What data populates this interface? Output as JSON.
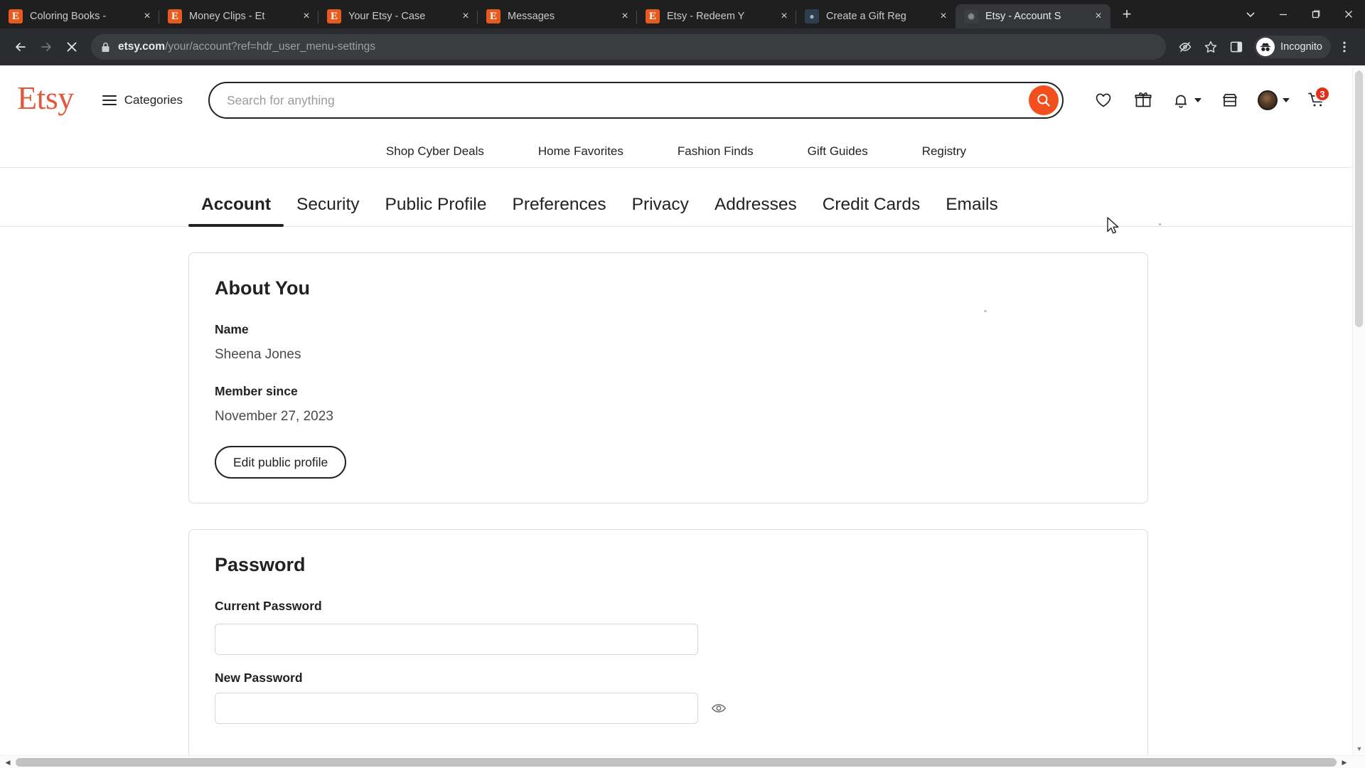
{
  "browser": {
    "tabs": [
      {
        "title": "Coloring Books -",
        "favicon": "etsy-icon",
        "active": false
      },
      {
        "title": "Money Clips - Et",
        "favicon": "etsy-icon",
        "active": false
      },
      {
        "title": "Your Etsy - Case",
        "favicon": "etsy-icon",
        "active": false
      },
      {
        "title": "Messages",
        "favicon": "etsy-icon",
        "active": false
      },
      {
        "title": "Etsy - Redeem Y",
        "favicon": "etsy-icon",
        "active": false
      },
      {
        "title": "Create a Gift Reg",
        "favicon": "generic-site-icon",
        "active": false
      },
      {
        "title": "Etsy - Account S",
        "favicon": "dim-site-icon",
        "active": true
      }
    ],
    "new_tab_label": "+",
    "close_label": "×",
    "window_controls": {
      "tab_search": "chevron-down-icon",
      "minimize": "minimize-icon",
      "maximize": "maximize-icon",
      "close": "close-icon"
    },
    "toolbar": {
      "back": "back-arrow-icon",
      "forward": "forward-arrow-icon",
      "stop": "stop-loading-icon",
      "lock": "lock-icon",
      "url_domain": "etsy.com",
      "url_path": "/your/account?ref=hdr_user_menu-settings",
      "tracking_protection": "eye-off-icon",
      "bookmark": "star-icon",
      "side_panel": "side-panel-icon",
      "incognito_label": "Incognito",
      "incognito_avatar": "incognito-hat-icon",
      "menu": "three-dot-menu-icon"
    }
  },
  "etsy": {
    "logo_text": "Etsy",
    "logo_color": "#e1593b",
    "accent_color": "#f1501e",
    "categories_label": "Categories",
    "search": {
      "placeholder": "Search for anything",
      "value": "",
      "button_icon": "search-icon"
    },
    "header_icons": [
      {
        "name": "favorites-icon",
        "label": "Favorites"
      },
      {
        "name": "gift-icon",
        "label": "Gifts"
      },
      {
        "name": "bell-icon",
        "label": "Notifications"
      },
      {
        "name": "shop-icon",
        "label": "Your shop"
      },
      {
        "name": "avatar-icon",
        "label": "You"
      },
      {
        "name": "cart-icon",
        "label": "Cart"
      }
    ],
    "cart_count": "3",
    "subnav": [
      {
        "label": "Shop Cyber Deals"
      },
      {
        "label": "Home Favorites"
      },
      {
        "label": "Fashion Finds"
      },
      {
        "label": "Gift Guides"
      },
      {
        "label": "Registry"
      }
    ]
  },
  "settings": {
    "tabs": [
      {
        "label": "Account",
        "active": true
      },
      {
        "label": "Security",
        "active": false
      },
      {
        "label": "Public Profile",
        "active": false
      },
      {
        "label": "Preferences",
        "active": false
      },
      {
        "label": "Privacy",
        "active": false
      },
      {
        "label": "Addresses",
        "active": false
      },
      {
        "label": "Credit Cards",
        "active": false
      },
      {
        "label": "Emails",
        "active": false
      }
    ],
    "about_you": {
      "heading": "About You",
      "name_label": "Name",
      "name_value": "Sheena Jones",
      "member_since_label": "Member since",
      "member_since_value": "November 27, 2023",
      "edit_button": "Edit public profile"
    },
    "password": {
      "heading": "Password",
      "current_label": "Current Password",
      "current_value": "",
      "new_label": "New Password",
      "new_value": "",
      "reveal_icon": "eye-icon"
    }
  }
}
